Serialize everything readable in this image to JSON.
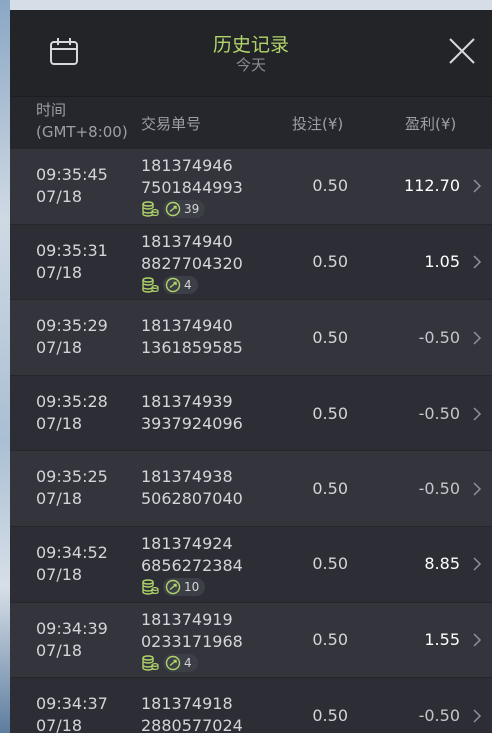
{
  "header": {
    "title": "历史记录",
    "subtitle": "今天"
  },
  "columns": {
    "time": "时间",
    "timezone": "(GMT+8:00)",
    "order_id": "交易单号",
    "bet": "投注(¥)",
    "profit": "盈利(¥)"
  },
  "rows": [
    {
      "time": "09:35:45",
      "date": "07/18",
      "id1": "181374946",
      "id2": "7501844993",
      "bet": "0.50",
      "profit": "112.70",
      "badge": "39"
    },
    {
      "time": "09:35:31",
      "date": "07/18",
      "id1": "181374940",
      "id2": "8827704320",
      "bet": "0.50",
      "profit": "1.05",
      "badge": "4"
    },
    {
      "time": "09:35:29",
      "date": "07/18",
      "id1": "181374940",
      "id2": "1361859585",
      "bet": "0.50",
      "profit": "-0.50",
      "badge": null
    },
    {
      "time": "09:35:28",
      "date": "07/18",
      "id1": "181374939",
      "id2": "3937924096",
      "bet": "0.50",
      "profit": "-0.50",
      "badge": null
    },
    {
      "time": "09:35:25",
      "date": "07/18",
      "id1": "181374938",
      "id2": "5062807040",
      "bet": "0.50",
      "profit": "-0.50",
      "badge": null
    },
    {
      "time": "09:34:52",
      "date": "07/18",
      "id1": "181374924",
      "id2": "6856272384",
      "bet": "0.50",
      "profit": "8.85",
      "badge": "10"
    },
    {
      "time": "09:34:39",
      "date": "07/18",
      "id1": "181374919",
      "id2": "0233171968",
      "bet": "0.50",
      "profit": "1.55",
      "badge": "4"
    },
    {
      "time": "09:34:37",
      "date": "07/18",
      "id1": "181374918",
      "id2": "2880577024",
      "bet": "0.50",
      "profit": "-0.50",
      "badge": null
    }
  ],
  "icons": {
    "calendar": "calendar-icon",
    "close": "close-icon",
    "coins": "coin-stack-icon",
    "free_spins": "free-spin-icon",
    "chevron": "chevron-right-icon"
  },
  "colors": {
    "accent_title": "#b0d56a",
    "panel": "#2b2c33"
  }
}
